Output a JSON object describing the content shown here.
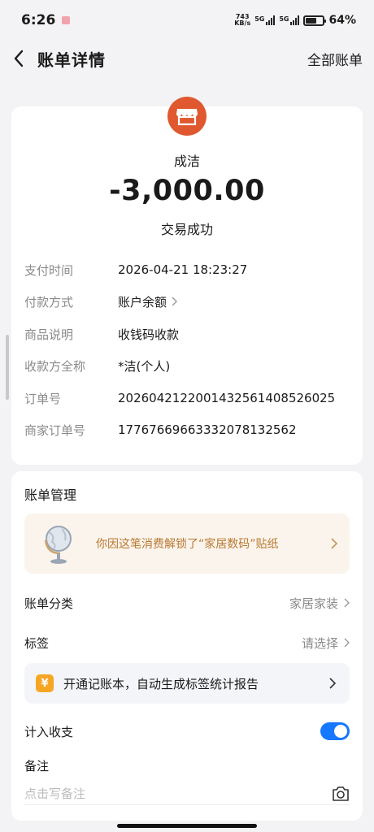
{
  "status_bar": {
    "time": "6:26",
    "net_speed_value": "743",
    "net_speed_unit": "KB/s",
    "sim1_label": "5G",
    "sim2_label": "5G",
    "battery_level": 0.64,
    "battery_text": "64%"
  },
  "nav": {
    "title": "账单详情",
    "right_link": "全部账单"
  },
  "summary": {
    "merchant_name": "成洁",
    "amount": "-3,000.00",
    "status": "交易成功",
    "logo_icon": "storefront-icon",
    "logo_color": "#e0582f"
  },
  "details": [
    {
      "label": "支付时间",
      "value": "2026-04-21 18:23:27"
    },
    {
      "label": "付款方式",
      "value": "账户余额"
    },
    {
      "label": "商品说明",
      "value": "收钱码收款"
    },
    {
      "label": "收款方全称",
      "value": "*洁(个人)"
    },
    {
      "label": "订单号",
      "value": "2026042122001432561408526025"
    },
    {
      "label": "商家订单号",
      "value": "17767669663332078132562"
    }
  ],
  "management": {
    "title": "账单管理",
    "sticker_text": "你因这笔消费解锁了“家居数码”贴纸",
    "category_label": "账单分类",
    "category_value": "家居家装",
    "tag_label": "标签",
    "tag_value": "请选择",
    "ledger_text": "开通记账本，自动生成标签统计报告",
    "ledger_icon_text": "¥",
    "include_label": "计入收支",
    "include_enabled": true,
    "note_label": "备注",
    "note_placeholder": "点击写备注"
  },
  "colors": {
    "accent_blue": "#1677ff",
    "sticker_text": "#b87932",
    "sticker_bg": "#fbf4ec",
    "ledger_icon": "#f5a623"
  }
}
